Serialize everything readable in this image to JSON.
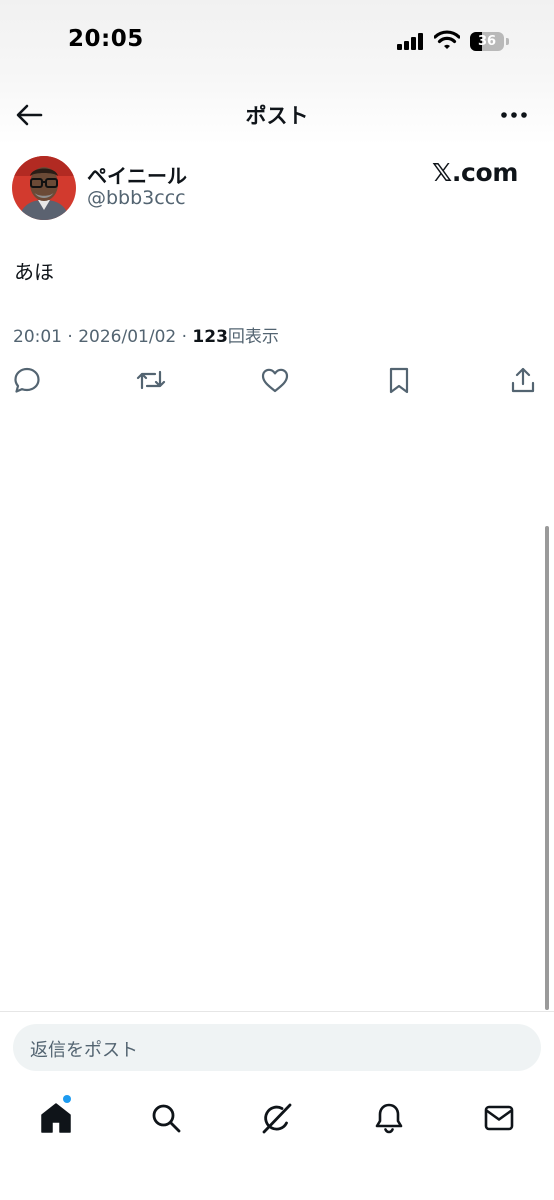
{
  "status_bar": {
    "time": "20:05",
    "battery": "36",
    "battery_level": 0.36
  },
  "header": {
    "title": "ポスト",
    "back_icon": "arrow-left-icon",
    "more_icon": "more-horizontal-icon"
  },
  "post": {
    "display_name": "ペイニール",
    "handle": "@bbb3ccc",
    "source_label": "𝕏.com",
    "text": "あほ",
    "time": "20:01",
    "separator": "·",
    "date": "2026/01/02",
    "views_count": "123",
    "views_label": "回表示",
    "actions": [
      "reply-icon",
      "repost-icon",
      "like-icon",
      "bookmark-icon",
      "share-icon"
    ]
  },
  "reply": {
    "placeholder": "返信をポスト"
  },
  "bottom_nav": {
    "items": [
      "home-icon",
      "search-icon",
      "grok-icon",
      "notifications-icon",
      "messages-icon"
    ],
    "accent_color": "#1d9bf0"
  },
  "colors": {
    "text_primary": "#0f1419",
    "text_secondary": "#536471",
    "composer_bg": "#eff3f4"
  }
}
